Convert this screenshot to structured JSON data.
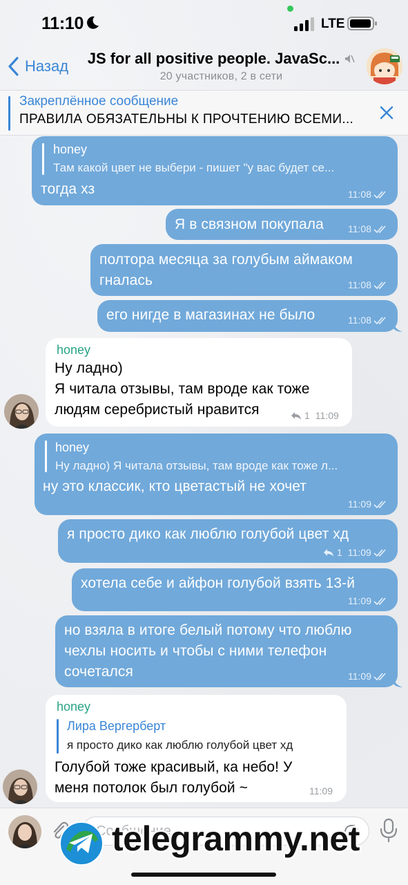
{
  "status_bar": {
    "time": "11:10",
    "network": "LTE",
    "icons": [
      "moon-icon",
      "signal-icon",
      "battery-icon"
    ]
  },
  "header": {
    "back_label": "Назад",
    "title": "JS for all positive people. JavaSc...",
    "subtitle": "20 участников, 2 в сети",
    "icons": [
      "chevron-left-icon",
      "mute-icon",
      "group-avatar"
    ]
  },
  "pinned": {
    "title": "Закреплённое сообщение",
    "text": "ПРАВИЛА ОБЯЗАТЕЛЬНЫ К ПРОЧТЕНИЮ ВСЕМИ..."
  },
  "messages": [
    {
      "direction": "out",
      "quote": {
        "name": "honey",
        "text": "Там какой цвет не выбери - пишет \"у вас будет се..."
      },
      "lines": [
        "тогда хз"
      ],
      "time": "11:08",
      "status": "read"
    },
    {
      "direction": "out",
      "lines": [
        "Я в связном покупала"
      ],
      "time": "11:08",
      "status": "read"
    },
    {
      "direction": "out",
      "lines": [
        "полтора месяца за голубым аймаком",
        "гналась"
      ],
      "time": "11:08",
      "status": "read"
    },
    {
      "direction": "out",
      "lines": [
        "его нигде в магазинах не было"
      ],
      "time": "11:08",
      "status": "read"
    },
    {
      "direction": "in",
      "sender": "honey",
      "lines": [
        "Ну ладно)",
        "Я читала отзывы, там вроде как тоже",
        "людям серебристый нравится"
      ],
      "replies": "1",
      "time": "11:09"
    },
    {
      "direction": "out",
      "quote": {
        "name": "honey",
        "text": "Ну ладно) Я читала отзывы, там вроде как тоже л..."
      },
      "lines": [
        "ну это классик, кто цветастый не хочет"
      ],
      "time": "11:09",
      "status": "read"
    },
    {
      "direction": "out",
      "lines": [
        "я просто дико как люблю голубой цвет хд"
      ],
      "replies": "1",
      "time": "11:09",
      "status": "read"
    },
    {
      "direction": "out",
      "lines": [
        "хотела себе и айфон голубой взять 13-й"
      ],
      "time": "11:09",
      "status": "read"
    },
    {
      "direction": "out",
      "lines": [
        "но взяла в итоге белый потому что люблю",
        "чехлы носить и чтобы с ними телефон",
        "сочетался"
      ],
      "time": "11:09",
      "status": "read"
    },
    {
      "direction": "in",
      "sender": "honey",
      "quote": {
        "name": "Лира Вергерберт",
        "text": "я просто дико как люблю голубой цвет хд"
      },
      "lines": [
        "Голубой тоже красивый, ка небо! У",
        "меня потолок был голубой ~"
      ],
      "time": "11:09"
    }
  ],
  "input": {
    "placeholder": "Сообщение",
    "icons": [
      "paperclip-icon",
      "sticker-icon",
      "mic-icon"
    ]
  },
  "watermark": {
    "text": "telegrammy.net"
  },
  "colors": {
    "accent": "#3a86d6",
    "outgoing_bubble": "#71a9da",
    "incoming_bubble": "#ffffff",
    "sender_name": "#28a486",
    "background": "#eceef1"
  }
}
